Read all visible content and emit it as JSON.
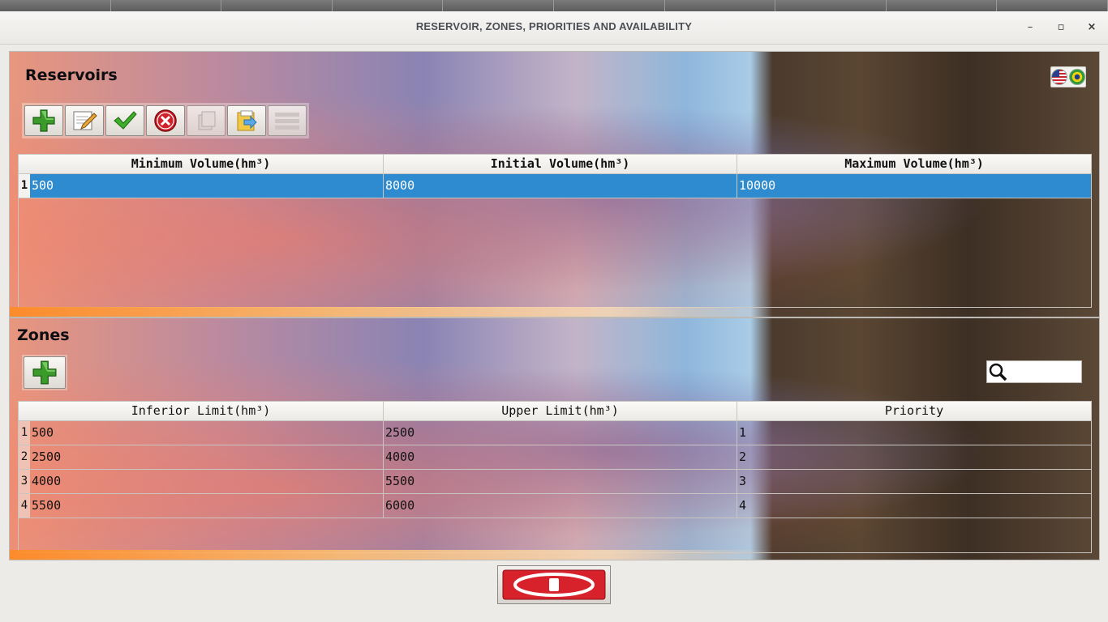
{
  "window": {
    "title": "RESERVOIR, ZONES, PRIORITIES AND AVAILABILITY",
    "controls": {
      "minimize": "–",
      "maximize": "▫",
      "close": "×"
    }
  },
  "reservoirs": {
    "title": "Reservoirs",
    "language_icons": [
      "us-flag-icon",
      "brazil-flag-icon"
    ],
    "toolbar": [
      "add-icon",
      "edit-icon",
      "confirm-icon",
      "delete-icon",
      "copy-icon",
      "export-icon",
      "menu-icon"
    ],
    "columns": [
      "Minimum Volume(hm³)",
      "Initial Volume(hm³)",
      "Maximum Volume(hm³)"
    ],
    "rows": [
      {
        "num": "1",
        "cells": [
          "500",
          "8000",
          "10000"
        ]
      }
    ]
  },
  "zones": {
    "title": "Zones",
    "toolbar": [
      "add-icon"
    ],
    "search": {
      "placeholder": "",
      "value": ""
    },
    "columns": [
      "Inferior Limit(hm³)",
      "Upper Limit(hm³)",
      "Priority"
    ],
    "rows": [
      {
        "num": "1",
        "cells": [
          "500",
          "2500",
          "1"
        ]
      },
      {
        "num": "2",
        "cells": [
          "2500",
          "4000",
          "2"
        ]
      },
      {
        "num": "3",
        "cells": [
          "4000",
          "5500",
          "3"
        ]
      },
      {
        "num": "4",
        "cells": [
          "5500",
          "6000",
          "4"
        ]
      }
    ]
  },
  "footer": {
    "exit_icon": "exit-icon"
  },
  "colors": {
    "selection": "#2f8bd0",
    "exit_red": "#d8222b",
    "add_green": "#3a9a2a"
  }
}
